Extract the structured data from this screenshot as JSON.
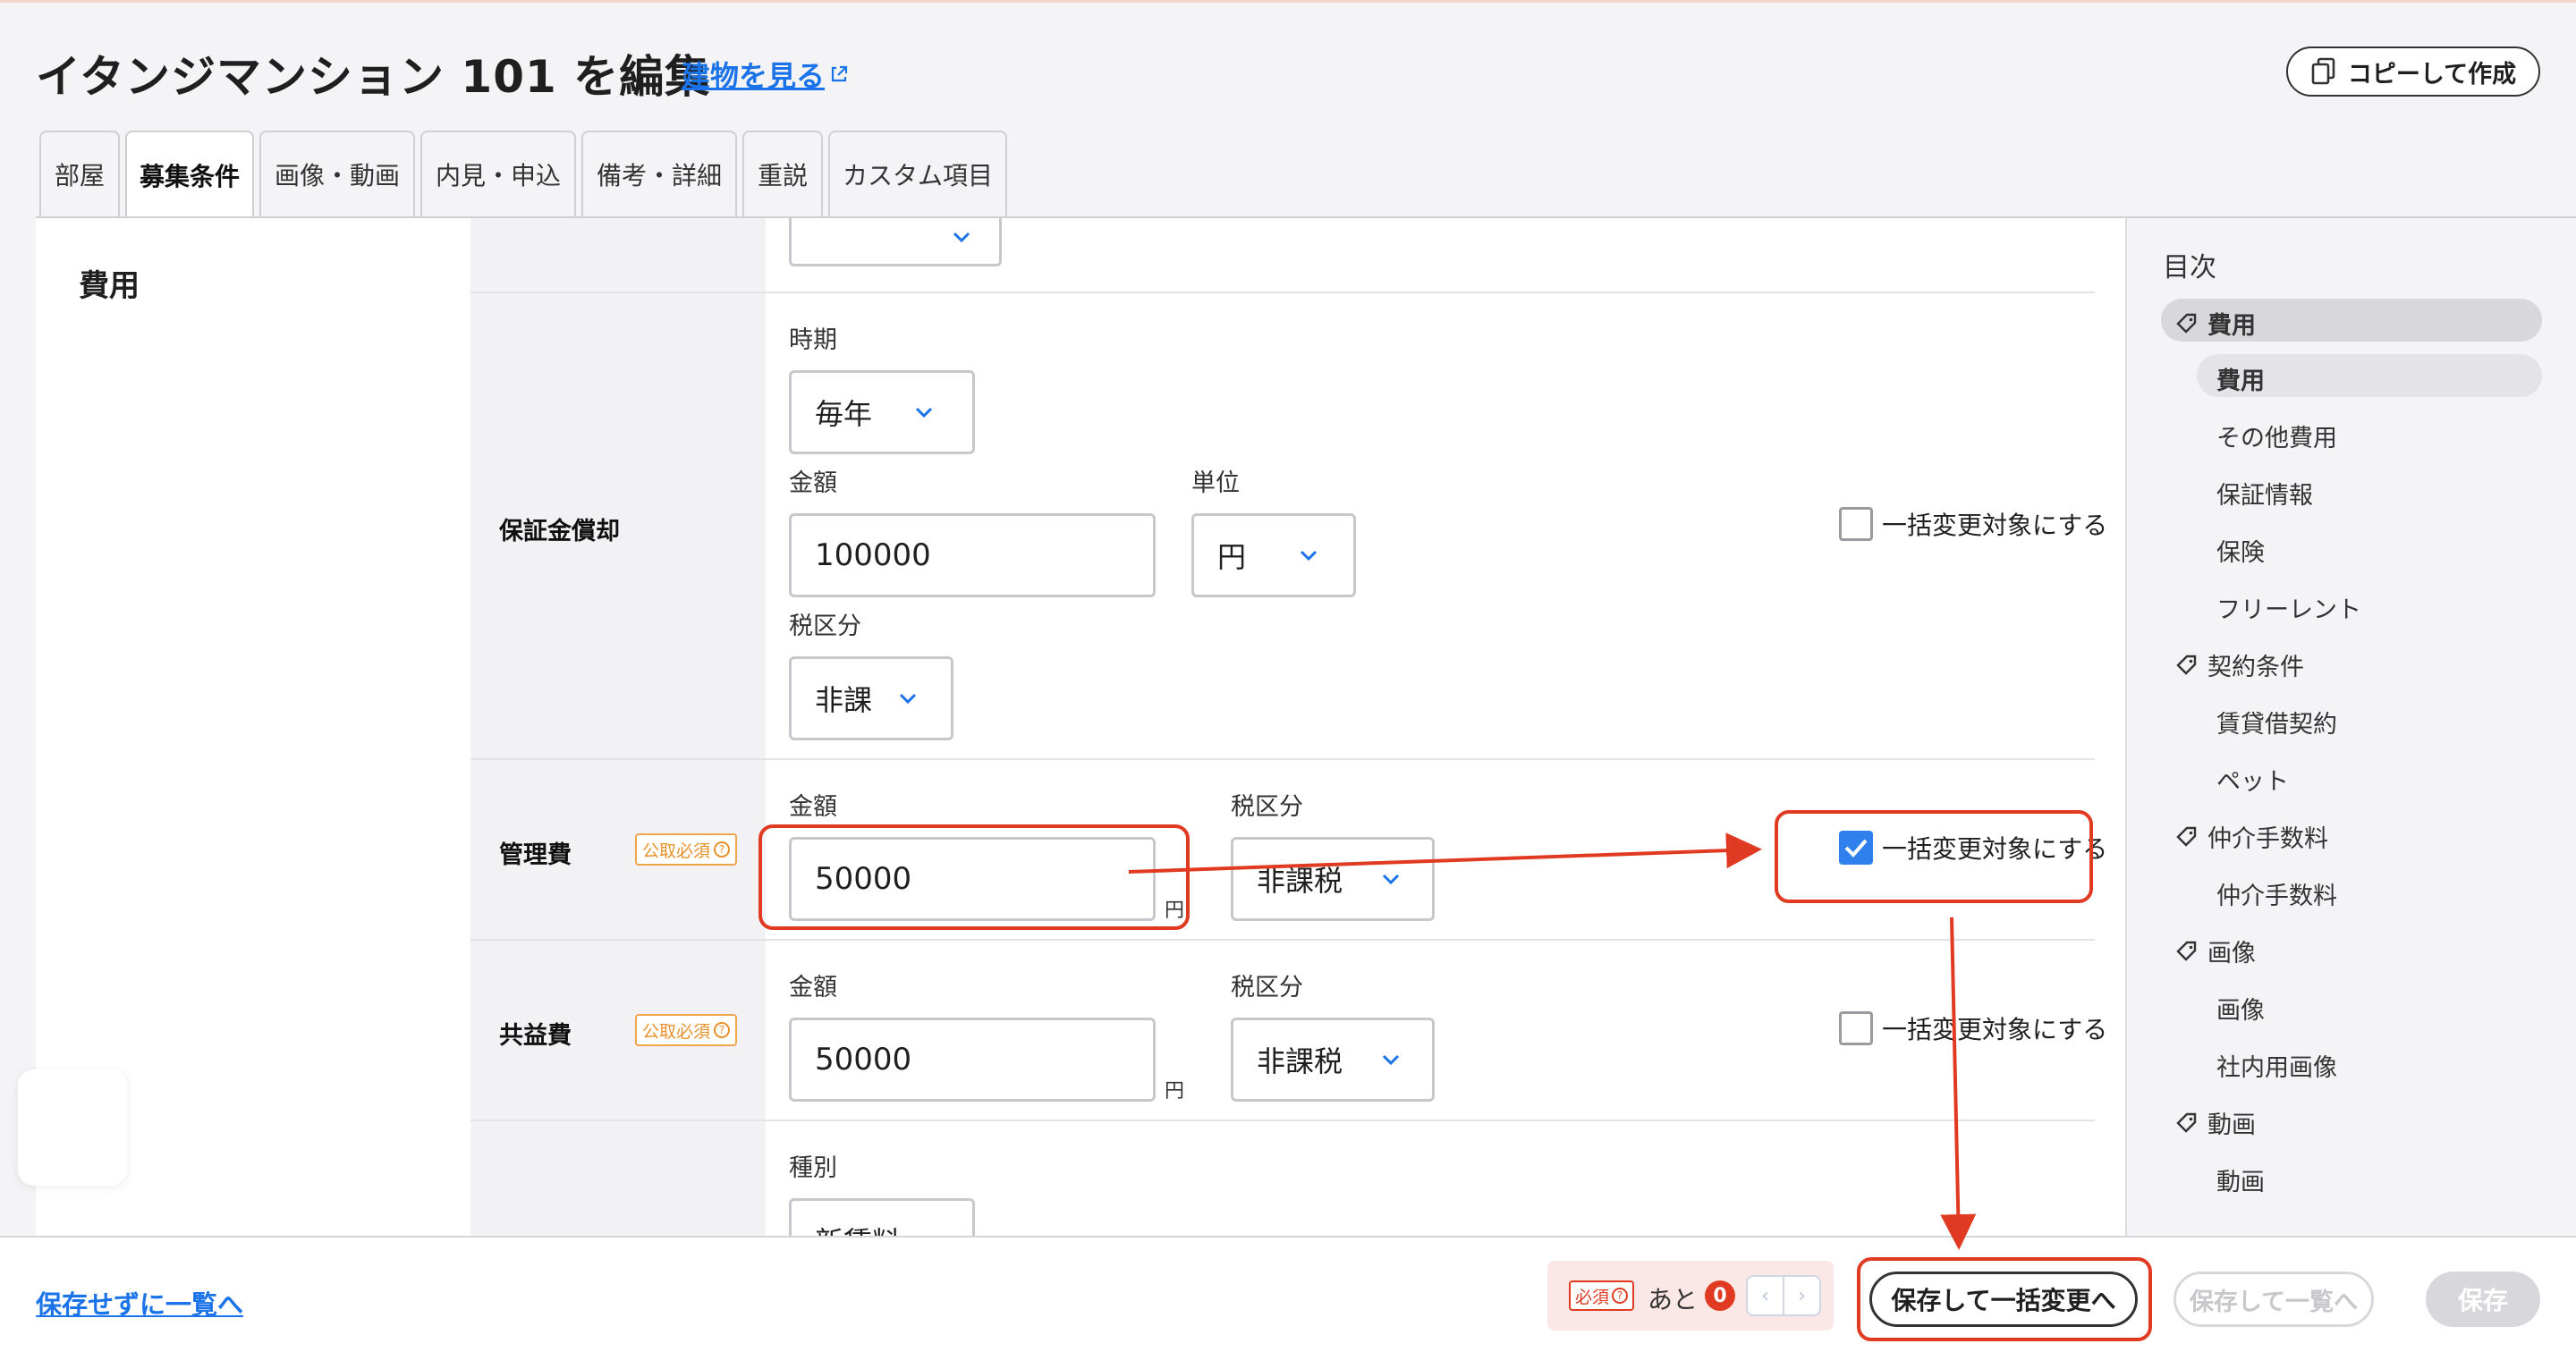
{
  "header": {
    "title": "イタンジマンション 101 を編集",
    "building_link": "建物を見る",
    "copy_button": "コピーして作成"
  },
  "tabs": [
    {
      "label": "部屋"
    },
    {
      "label": "募集条件"
    },
    {
      "label": "画像・動画"
    },
    {
      "label": "内見・申込"
    },
    {
      "label": "備考・詳細"
    },
    {
      "label": "重説"
    },
    {
      "label": "カスタム項目"
    }
  ],
  "section": {
    "title": "費用"
  },
  "deposit_amortization": {
    "row_label": "保証金償却",
    "period_label": "時期",
    "period_value": "毎年",
    "amount_label": "金額",
    "amount_value": "100000",
    "unit_label": "単位",
    "unit_value": "円",
    "tax_label": "税区分",
    "tax_value": "非課",
    "bulk_label": "一括変更対象にする"
  },
  "management_fee": {
    "row_label": "管理費",
    "required_badge": "公取必須",
    "amount_label": "金額",
    "amount_value": "50000",
    "unit": "円",
    "tax_label": "税区分",
    "tax_value": "非課税",
    "bulk_label": "一括変更対象にする"
  },
  "common_fee": {
    "row_label": "共益費",
    "required_badge": "公取必須",
    "amount_label": "金額",
    "amount_value": "50000",
    "unit": "円",
    "tax_label": "税区分",
    "tax_value": "非課税",
    "bulk_label": "一括変更対象にする"
  },
  "next_row": {
    "type_label": "種別",
    "type_value": "新賃料"
  },
  "toc": {
    "title": "目次",
    "items": [
      {
        "label": "費用",
        "kind": "section"
      },
      {
        "label": "費用",
        "kind": "sub"
      },
      {
        "label": "その他費用",
        "kind": "sub"
      },
      {
        "label": "保証情報",
        "kind": "sub"
      },
      {
        "label": "保険",
        "kind": "sub"
      },
      {
        "label": "フリーレント",
        "kind": "sub"
      },
      {
        "label": "契約条件",
        "kind": "section"
      },
      {
        "label": "賃貸借契約",
        "kind": "sub"
      },
      {
        "label": "ペット",
        "kind": "sub"
      },
      {
        "label": "仲介手数料",
        "kind": "section"
      },
      {
        "label": "仲介手数料",
        "kind": "sub"
      },
      {
        "label": "画像",
        "kind": "section"
      },
      {
        "label": "画像",
        "kind": "sub"
      },
      {
        "label": "社内用画像",
        "kind": "sub"
      },
      {
        "label": "動画",
        "kind": "section"
      },
      {
        "label": "動画",
        "kind": "sub"
      }
    ]
  },
  "footer": {
    "back_link": "保存せずに一覧へ",
    "required_badge": "必須",
    "remaining_prefix": "あと",
    "remaining_count": "0",
    "prev_symbol": "‹",
    "next_symbol": "›",
    "save_bulk": "保存して一括変更へ",
    "save_list": "保存して一覧へ",
    "save": "保存"
  },
  "colors": {
    "accent": "#1a73e8",
    "highlight": "#e03b22",
    "required_orange": "#e8912b",
    "checkbox_on": "#2f80ed"
  }
}
